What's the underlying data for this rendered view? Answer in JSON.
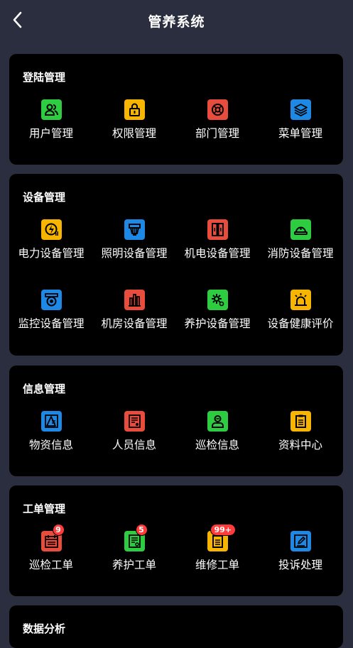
{
  "header": {
    "title": "管养系统"
  },
  "sections": [
    {
      "title": "登陆管理",
      "items": [
        {
          "label": "用户管理",
          "icon": "users-icon",
          "color": "#2ecc40"
        },
        {
          "label": "权限管理",
          "icon": "lock-icon",
          "color": "#f7b500"
        },
        {
          "label": "部门管理",
          "icon": "department-icon",
          "color": "#e74c3c"
        },
        {
          "label": "菜单管理",
          "icon": "layers-icon",
          "color": "#1e88e5"
        }
      ]
    },
    {
      "title": "设备管理",
      "items": [
        {
          "label": "电力设备管理",
          "icon": "power-icon",
          "color": "#f7b500"
        },
        {
          "label": "照明设备管理",
          "icon": "lighting-icon",
          "color": "#1e88e5"
        },
        {
          "label": "机电设备管理",
          "icon": "cabinet-icon",
          "color": "#e74c3c"
        },
        {
          "label": "消防设备管理",
          "icon": "helmet-icon",
          "color": "#2ecc40"
        },
        {
          "label": "监控设备管理",
          "icon": "camera-icon",
          "color": "#1e88e5"
        },
        {
          "label": "机房设备管理",
          "icon": "server-room-icon",
          "color": "#e74c3c"
        },
        {
          "label": "养护设备管理",
          "icon": "gear-icon",
          "color": "#2ecc40"
        },
        {
          "label": "设备健康评价",
          "icon": "alarm-icon",
          "color": "#f7b500"
        }
      ]
    },
    {
      "title": "信息管理",
      "items": [
        {
          "label": "物资信息",
          "icon": "materials-icon",
          "color": "#1e88e5"
        },
        {
          "label": "人员信息",
          "icon": "person-card-icon",
          "color": "#e74c3c"
        },
        {
          "label": "巡检信息",
          "icon": "inspector-icon",
          "color": "#2ecc40"
        },
        {
          "label": "资料中心",
          "icon": "clipboard-icon",
          "color": "#f7b500"
        }
      ]
    },
    {
      "title": "工单管理",
      "items": [
        {
          "label": "巡检工单",
          "icon": "calendar-icon",
          "color": "#e74c3c",
          "badge": "9"
        },
        {
          "label": "养护工单",
          "icon": "maintenance-order-icon",
          "color": "#2ecc40",
          "badge": "5"
        },
        {
          "label": "维修工单",
          "icon": "repair-order-icon",
          "color": "#f7b500",
          "badge": "99+"
        },
        {
          "label": "投诉处理",
          "icon": "edit-icon",
          "color": "#1e88e5"
        }
      ]
    },
    {
      "title": "数据分析",
      "items": []
    }
  ]
}
